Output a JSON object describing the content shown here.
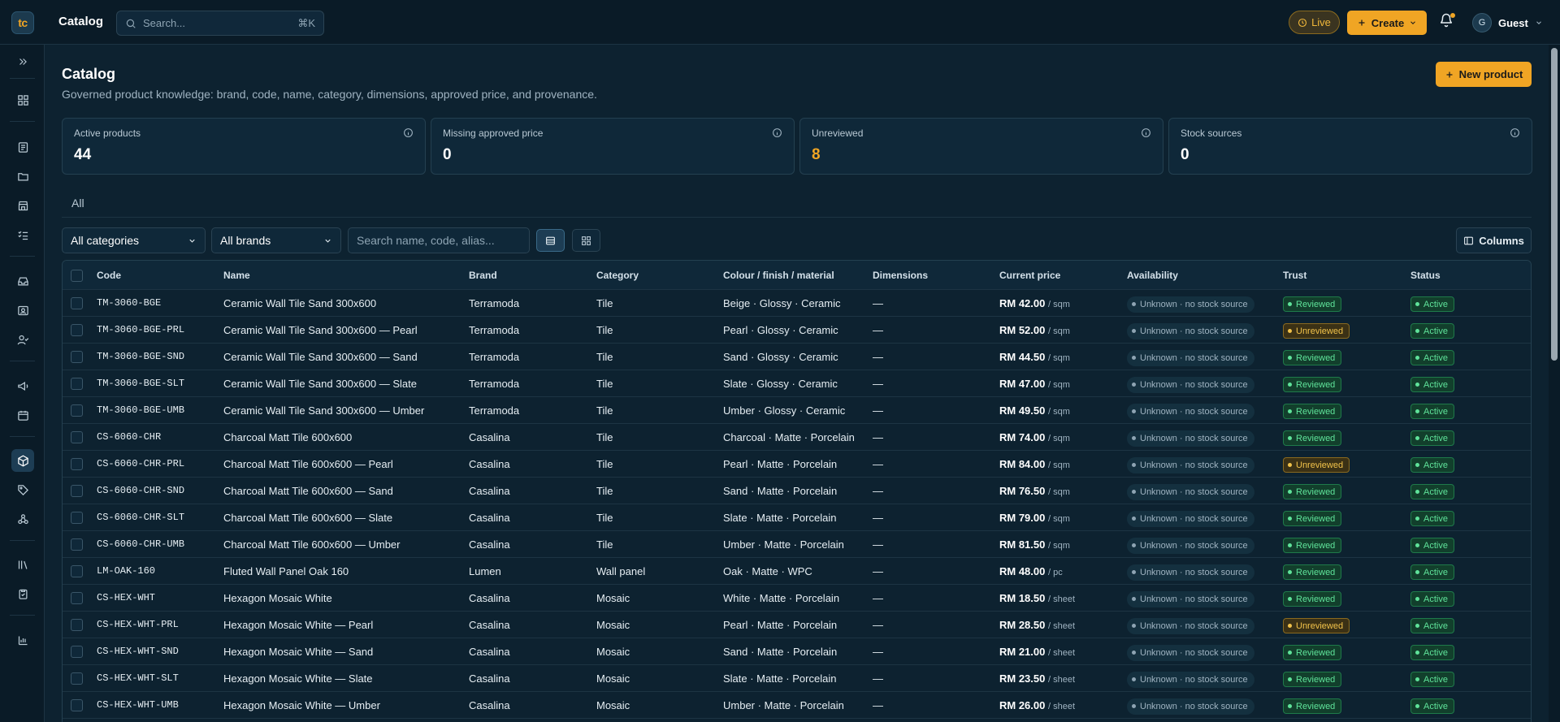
{
  "app": {
    "logo_text": "tc",
    "title": "Catalog",
    "search_placeholder": "Search...",
    "search_shortcut": "⌘K",
    "live_label": "Live",
    "create_label": "Create",
    "user_initial": "G",
    "user_name": "Guest",
    "accent_color": "#f0a524"
  },
  "sidebar": {
    "icons": [
      "expand-icon",
      "dashboard-icon",
      "document-icon",
      "folder-icon",
      "store-icon",
      "checklist-icon",
      "inbox-icon",
      "contact-card-icon",
      "user-check-icon",
      "megaphone-icon",
      "calendar-icon",
      "package-icon",
      "tag-icon",
      "network-icon",
      "library-icon",
      "clipboard-check-icon",
      "bar-chart-icon"
    ],
    "active": "package-icon"
  },
  "page": {
    "title": "Catalog",
    "subtitle": "Governed product knowledge: brand, code, name, category, dimensions, approved price, and provenance.",
    "new_product_label": "New product"
  },
  "stats": [
    {
      "label": "Active products",
      "value": "44"
    },
    {
      "label": "Missing approved price",
      "value": "0"
    },
    {
      "label": "Unreviewed",
      "value": "8"
    },
    {
      "label": "Stock sources",
      "value": "0"
    }
  ],
  "tabs": {
    "all": "All"
  },
  "filters": {
    "category": "All categories",
    "brand": "All brands",
    "search_placeholder": "Search name, code, alias...",
    "columns_label": "Columns"
  },
  "table": {
    "headers": {
      "code": "Code",
      "name": "Name",
      "brand": "Brand",
      "category": "Category",
      "colour": "Colour / finish / material",
      "dimensions": "Dimensions",
      "price": "Current price",
      "availability": "Availability",
      "trust": "Trust",
      "status": "Status"
    },
    "rows": [
      {
        "code": "TM-3060-BGE",
        "name": "Ceramic Wall Tile Sand 300x600",
        "brand": "Terramoda",
        "category": "Tile",
        "colour": "Beige · Glossy · Ceramic",
        "dimensions": "—",
        "price": "RM 42.00",
        "unit": "/ sqm",
        "availability": "Unknown · no stock source",
        "trust": "Reviewed",
        "status": "Active"
      },
      {
        "code": "TM-3060-BGE-PRL",
        "name": "Ceramic Wall Tile Sand 300x600 — Pearl",
        "brand": "Terramoda",
        "category": "Tile",
        "colour": "Pearl · Glossy · Ceramic",
        "dimensions": "—",
        "price": "RM 52.00",
        "unit": "/ sqm",
        "availability": "Unknown · no stock source",
        "trust": "Unreviewed",
        "status": "Active"
      },
      {
        "code": "TM-3060-BGE-SND",
        "name": "Ceramic Wall Tile Sand 300x600 — Sand",
        "brand": "Terramoda",
        "category": "Tile",
        "colour": "Sand · Glossy · Ceramic",
        "dimensions": "—",
        "price": "RM 44.50",
        "unit": "/ sqm",
        "availability": "Unknown · no stock source",
        "trust": "Reviewed",
        "status": "Active"
      },
      {
        "code": "TM-3060-BGE-SLT",
        "name": "Ceramic Wall Tile Sand 300x600 — Slate",
        "brand": "Terramoda",
        "category": "Tile",
        "colour": "Slate · Glossy · Ceramic",
        "dimensions": "—",
        "price": "RM 47.00",
        "unit": "/ sqm",
        "availability": "Unknown · no stock source",
        "trust": "Reviewed",
        "status": "Active"
      },
      {
        "code": "TM-3060-BGE-UMB",
        "name": "Ceramic Wall Tile Sand 300x600 — Umber",
        "brand": "Terramoda",
        "category": "Tile",
        "colour": "Umber · Glossy · Ceramic",
        "dimensions": "—",
        "price": "RM 49.50",
        "unit": "/ sqm",
        "availability": "Unknown · no stock source",
        "trust": "Reviewed",
        "status": "Active"
      },
      {
        "code": "CS-6060-CHR",
        "name": "Charcoal Matt Tile 600x600",
        "brand": "Casalina",
        "category": "Tile",
        "colour": "Charcoal · Matte · Porcelain",
        "dimensions": "—",
        "price": "RM 74.00",
        "unit": "/ sqm",
        "availability": "Unknown · no stock source",
        "trust": "Reviewed",
        "status": "Active"
      },
      {
        "code": "CS-6060-CHR-PRL",
        "name": "Charcoal Matt Tile 600x600 — Pearl",
        "brand": "Casalina",
        "category": "Tile",
        "colour": "Pearl · Matte · Porcelain",
        "dimensions": "—",
        "price": "RM 84.00",
        "unit": "/ sqm",
        "availability": "Unknown · no stock source",
        "trust": "Unreviewed",
        "status": "Active"
      },
      {
        "code": "CS-6060-CHR-SND",
        "name": "Charcoal Matt Tile 600x600 — Sand",
        "brand": "Casalina",
        "category": "Tile",
        "colour": "Sand · Matte · Porcelain",
        "dimensions": "—",
        "price": "RM 76.50",
        "unit": "/ sqm",
        "availability": "Unknown · no stock source",
        "trust": "Reviewed",
        "status": "Active"
      },
      {
        "code": "CS-6060-CHR-SLT",
        "name": "Charcoal Matt Tile 600x600 — Slate",
        "brand": "Casalina",
        "category": "Tile",
        "colour": "Slate · Matte · Porcelain",
        "dimensions": "—",
        "price": "RM 79.00",
        "unit": "/ sqm",
        "availability": "Unknown · no stock source",
        "trust": "Reviewed",
        "status": "Active"
      },
      {
        "code": "CS-6060-CHR-UMB",
        "name": "Charcoal Matt Tile 600x600 — Umber",
        "brand": "Casalina",
        "category": "Tile",
        "colour": "Umber · Matte · Porcelain",
        "dimensions": "—",
        "price": "RM 81.50",
        "unit": "/ sqm",
        "availability": "Unknown · no stock source",
        "trust": "Reviewed",
        "status": "Active"
      },
      {
        "code": "LM-OAK-160",
        "name": "Fluted Wall Panel Oak 160",
        "brand": "Lumen",
        "category": "Wall panel",
        "colour": "Oak · Matte · WPC",
        "dimensions": "—",
        "price": "RM 48.00",
        "unit": "/ pc",
        "availability": "Unknown · no stock source",
        "trust": "Reviewed",
        "status": "Active"
      },
      {
        "code": "CS-HEX-WHT",
        "name": "Hexagon Mosaic White",
        "brand": "Casalina",
        "category": "Mosaic",
        "colour": "White · Matte · Porcelain",
        "dimensions": "—",
        "price": "RM 18.50",
        "unit": "/ sheet",
        "availability": "Unknown · no stock source",
        "trust": "Reviewed",
        "status": "Active"
      },
      {
        "code": "CS-HEX-WHT-PRL",
        "name": "Hexagon Mosaic White — Pearl",
        "brand": "Casalina",
        "category": "Mosaic",
        "colour": "Pearl · Matte · Porcelain",
        "dimensions": "—",
        "price": "RM 28.50",
        "unit": "/ sheet",
        "availability": "Unknown · no stock source",
        "trust": "Unreviewed",
        "status": "Active"
      },
      {
        "code": "CS-HEX-WHT-SND",
        "name": "Hexagon Mosaic White — Sand",
        "brand": "Casalina",
        "category": "Mosaic",
        "colour": "Sand · Matte · Porcelain",
        "dimensions": "—",
        "price": "RM 21.00",
        "unit": "/ sheet",
        "availability": "Unknown · no stock source",
        "trust": "Reviewed",
        "status": "Active"
      },
      {
        "code": "CS-HEX-WHT-SLT",
        "name": "Hexagon Mosaic White — Slate",
        "brand": "Casalina",
        "category": "Mosaic",
        "colour": "Slate · Matte · Porcelain",
        "dimensions": "—",
        "price": "RM 23.50",
        "unit": "/ sheet",
        "availability": "Unknown · no stock source",
        "trust": "Reviewed",
        "status": "Active"
      },
      {
        "code": "CS-HEX-WHT-UMB",
        "name": "Hexagon Mosaic White — Umber",
        "brand": "Casalina",
        "category": "Mosaic",
        "colour": "Umber · Matte · Porcelain",
        "dimensions": "—",
        "price": "RM 26.00",
        "unit": "/ sheet",
        "availability": "Unknown · no stock source",
        "trust": "Reviewed",
        "status": "Active"
      }
    ]
  }
}
